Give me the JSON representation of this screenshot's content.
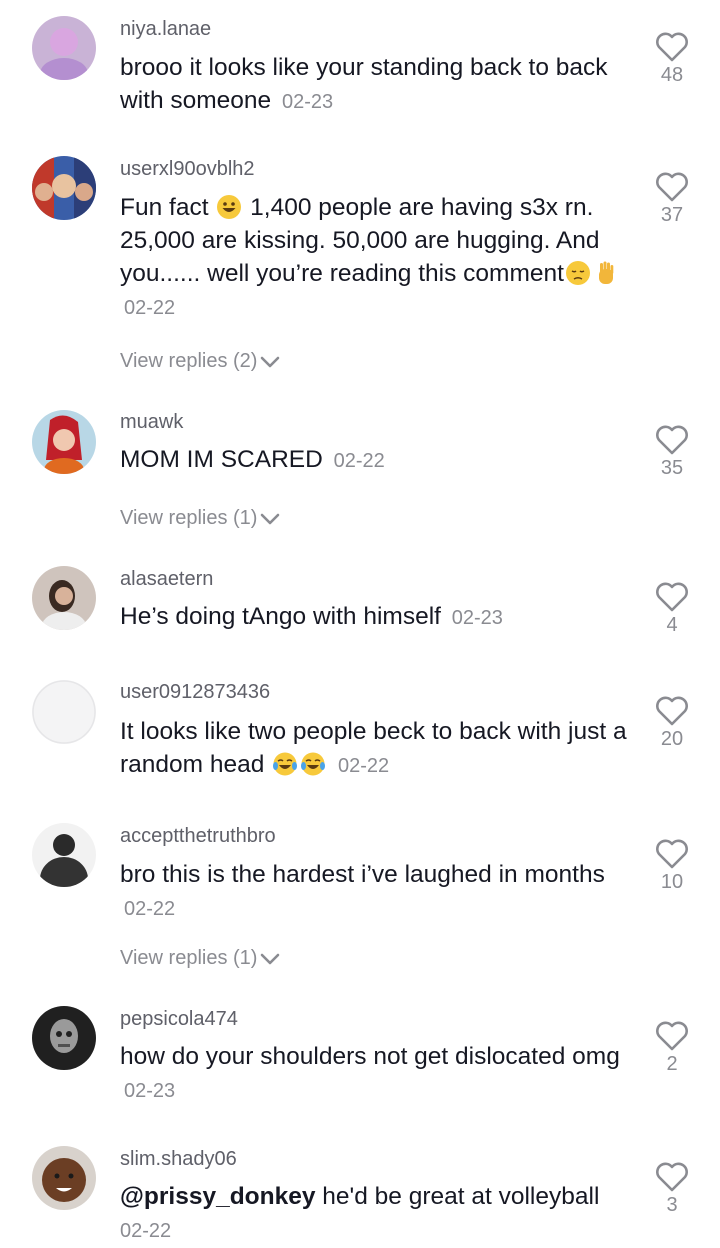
{
  "comments": [
    {
      "username": "niya.lanae",
      "text": "brooo it looks like your standing back to back with someone",
      "date": "02-23",
      "likes": "48"
    },
    {
      "username": "userxl90ovblh2",
      "text_a": "Fun fact",
      "text_b": "1,400 people are having s3x rn. 25,000 are kissing. 50,000 are hugging. And you...... well you’re reading this comment",
      "date": "02-22",
      "likes": "37",
      "replies": "View replies (2)",
      "emojis": [
        "grinning-face-emoji",
        "pensive-face-emoji",
        "raised-hand-emoji"
      ]
    },
    {
      "username": "muawk",
      "text": "MOM IM SCARED",
      "date": "02-22",
      "likes": "35",
      "replies": "View replies (1)"
    },
    {
      "username": "alasaetern",
      "text": "He’s doing tAngo with himself",
      "date": "02-23",
      "likes": "4"
    },
    {
      "username": "user0912873436",
      "text": "It looks like two people beck to back with just a random head",
      "date": "02-22",
      "likes": "20",
      "emojis": [
        "tears-of-joy-emoji",
        "tears-of-joy-emoji"
      ]
    },
    {
      "username": "acceptthetruthbro",
      "text": "bro this is the hardest i’ve laughed in months",
      "date": "02-22",
      "likes": "10",
      "replies": "View replies (1)"
    },
    {
      "username": "pepsicola474",
      "text": "how do your shoulders not get dislocated omg",
      "date": "02-23",
      "likes": "2"
    },
    {
      "username": "slim.shady06",
      "mention": "@prissy_donkey",
      "text": "he'd be great at volleyball",
      "date": "02-22",
      "likes": "3"
    }
  ],
  "colors": {
    "text": "#161823",
    "muted": "#8a8b91",
    "username": "#5f6069"
  }
}
